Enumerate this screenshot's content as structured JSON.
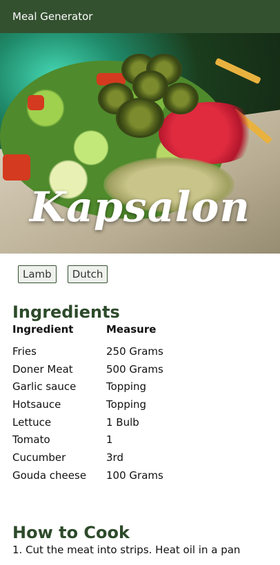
{
  "app": {
    "title": "Meal Generator"
  },
  "meal": {
    "name": "Kapsalon",
    "tags": [
      "Lamb",
      "Dutch"
    ],
    "image_icon": "meal-photo"
  },
  "ingredients": {
    "heading": "Ingredients",
    "columns": [
      "Ingredient",
      "Measure"
    ],
    "rows": [
      [
        "Fries",
        "250 Grams"
      ],
      [
        "Doner Meat",
        "500 Grams"
      ],
      [
        "Garlic sauce",
        "Topping"
      ],
      [
        "Hotsauce",
        "Topping"
      ],
      [
        "Lettuce",
        "1 Bulb"
      ],
      [
        "Tomato",
        "1"
      ],
      [
        "Cucumber",
        "3rd"
      ],
      [
        "Gouda cheese",
        "100 Grams"
      ]
    ]
  },
  "instructions": {
    "heading": "How to Cook",
    "first_step": "1. Cut the meat into strips. Heat oil in a pan"
  },
  "colors": {
    "header_bg": "#33502f",
    "heading_text": "#2d4a2a"
  }
}
